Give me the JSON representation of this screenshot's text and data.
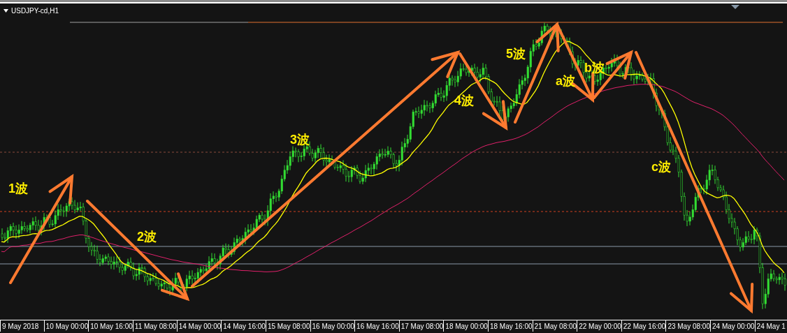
{
  "chart": {
    "title": "USDJPY-cd,H1",
    "wave_labels": [
      {
        "text": "1波"
      },
      {
        "text": "2波"
      },
      {
        "text": "3波"
      },
      {
        "text": "4波"
      },
      {
        "text": "5波"
      },
      {
        "text": "a波"
      },
      {
        "text": "b波"
      },
      {
        "text": "c波"
      }
    ],
    "x_axis_labels": [
      "9 May 2018",
      "10 May 00:00",
      "10 May 16:00",
      "11 May 08:00",
      "14 May 00:00",
      "14 May 16:00",
      "15 May 08:00",
      "16 May 00:00",
      "16 May 16:00",
      "17 May 08:00",
      "18 May 00:00",
      "18 May 16:00",
      "21 May 08:00",
      "22 May 00:00",
      "22 May 16:00",
      "23 May 08:00",
      "24 May 00:00",
      "24 May 1"
    ]
  }
}
